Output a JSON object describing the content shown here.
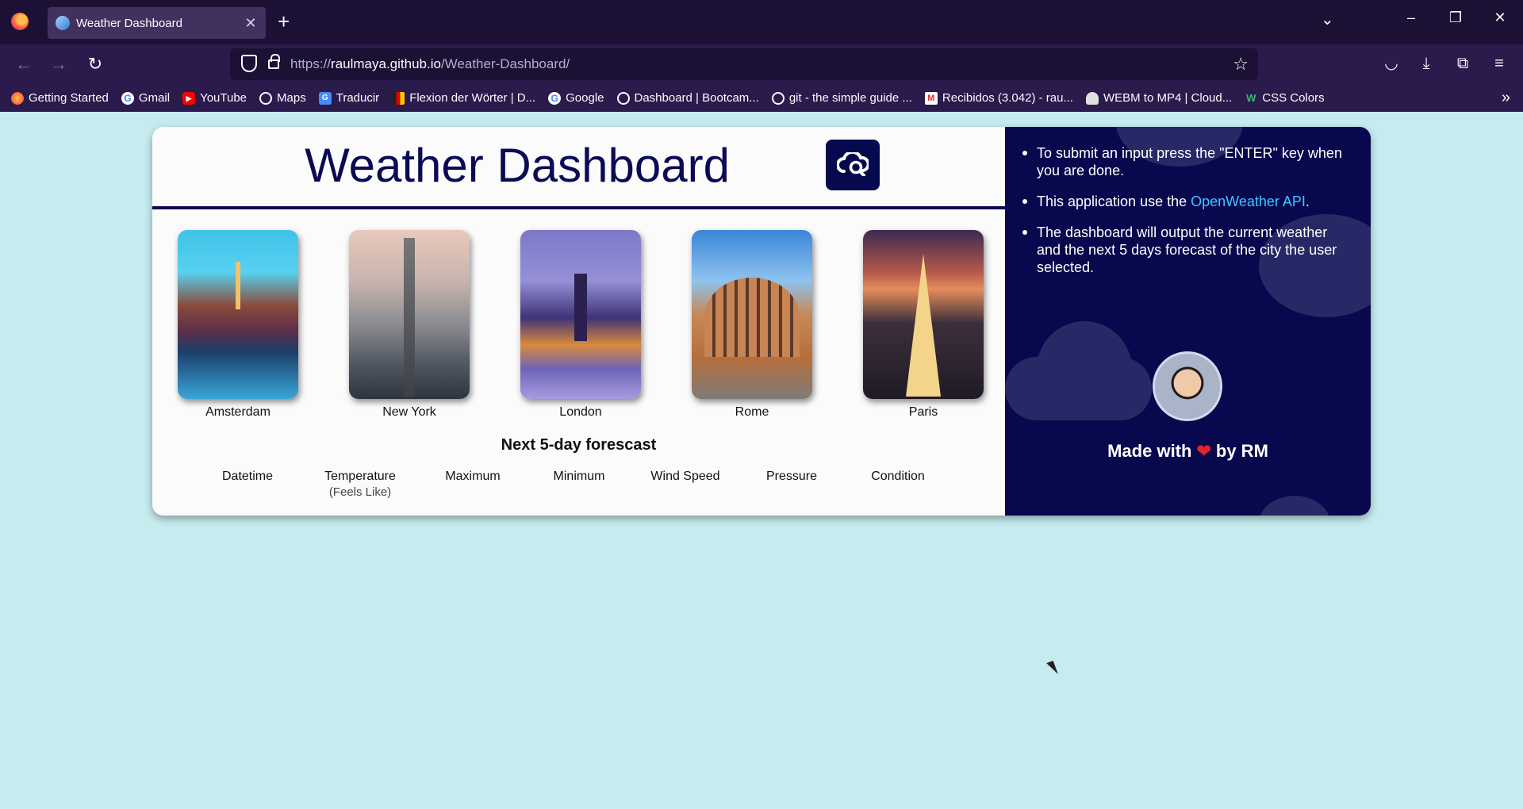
{
  "browser": {
    "tab_title": "Weather Dashboard",
    "url_prefix": "https://",
    "url_host": "raulmaya.github.io",
    "url_path": "/Weather-Dashboard/",
    "bookmarks": [
      {
        "label": "Getting Started",
        "icon": "firefox-icon"
      },
      {
        "label": "Gmail",
        "icon": "google-icon"
      },
      {
        "label": "YouTube",
        "icon": "youtube-icon"
      },
      {
        "label": "Maps",
        "icon": "globe-icon"
      },
      {
        "label": "Traducir",
        "icon": "translate-icon"
      },
      {
        "label": "Flexion der Wörter | D...",
        "icon": "flag-icon"
      },
      {
        "label": "Google",
        "icon": "google-icon"
      },
      {
        "label": "Dashboard | Bootcam...",
        "icon": "globe-icon"
      },
      {
        "label": "git - the simple guide ...",
        "icon": "globe-icon"
      },
      {
        "label": "Recibidos (3.042) - rau...",
        "icon": "gmail-icon"
      },
      {
        "label": "WEBM to MP4 | Cloud...",
        "icon": "cloud-icon"
      },
      {
        "label": "CSS Colors",
        "icon": "w-icon"
      }
    ]
  },
  "header": {
    "title": "Weather Dashboard"
  },
  "cities": [
    {
      "name": "Amsterdam"
    },
    {
      "name": "New York"
    },
    {
      "name": "London"
    },
    {
      "name": "Rome"
    },
    {
      "name": "Paris"
    }
  ],
  "forecast": {
    "title": "Next 5-day forescast",
    "columns": [
      {
        "label": "Datetime",
        "sub": ""
      },
      {
        "label": "Temperature",
        "sub": "(Feels Like)"
      },
      {
        "label": "Maximum",
        "sub": ""
      },
      {
        "label": "Minimum",
        "sub": ""
      },
      {
        "label": "Wind Speed",
        "sub": ""
      },
      {
        "label": "Pressure",
        "sub": ""
      },
      {
        "label": "Condition",
        "sub": ""
      }
    ]
  },
  "sidebar": {
    "info": [
      {
        "text": "To submit an input press the \"ENTER\" key when you are done."
      },
      {
        "prefix": "This application use the ",
        "link": "OpenWeather API",
        "suffix": "."
      },
      {
        "text": "The dashboard will output the current weather and the next 5 days forecast of the city the user selected."
      }
    ],
    "made_prefix": "Made with",
    "made_heart": "❤",
    "made_suffix": "by RM"
  },
  "colors": {
    "page_bg": "#c6ecef",
    "title": "#0a0a55",
    "sidebar_bg": "#07084d",
    "link": "#3ec6ff",
    "heart": "#e3232d"
  }
}
